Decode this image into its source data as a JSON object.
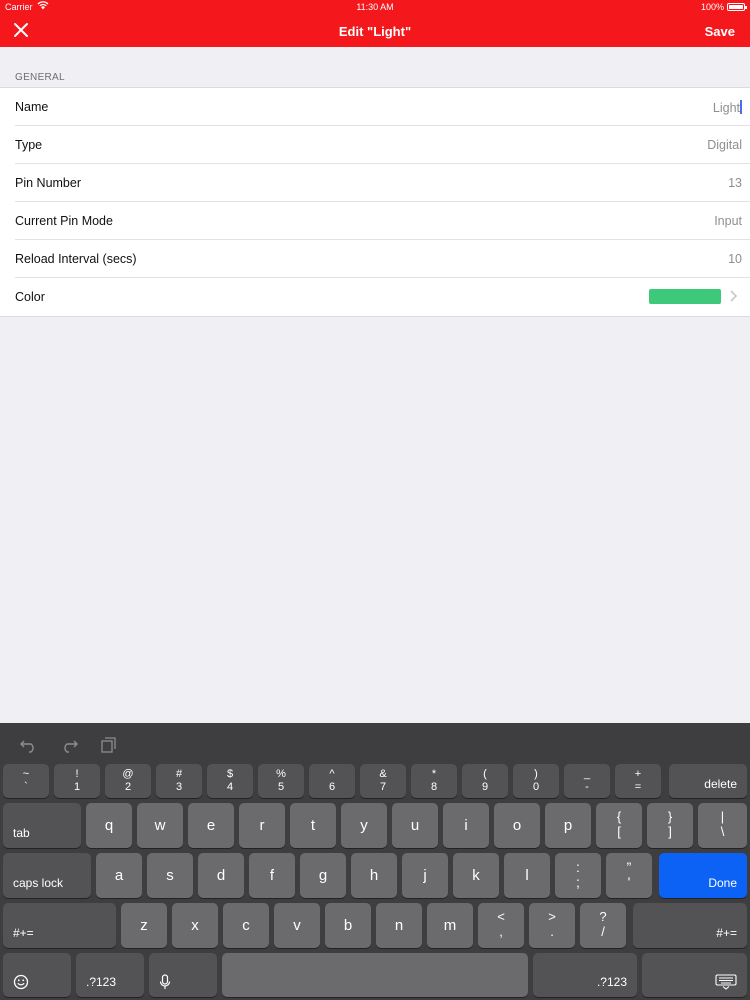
{
  "status_bar": {
    "carrier": "Carrier",
    "time": "11:30 AM",
    "battery": "100%"
  },
  "nav": {
    "title": "Edit \"Light\"",
    "save_label": "Save",
    "close_icon": "close-icon"
  },
  "section": {
    "header": "GENERAL",
    "rows": [
      {
        "label": "Name",
        "value": "Light"
      },
      {
        "label": "Type",
        "value": "Digital"
      },
      {
        "label": "Pin Number",
        "value": "13"
      },
      {
        "label": "Current Pin Mode",
        "value": "Input"
      },
      {
        "label": "Reload Interval (secs)",
        "value": "10"
      },
      {
        "label": "Color",
        "value": ""
      }
    ],
    "color_value": "#3ec97a"
  },
  "keyboard": {
    "number_row": [
      {
        "top": "~",
        "bottom": "`"
      },
      {
        "top": "!",
        "bottom": "1"
      },
      {
        "top": "@",
        "bottom": "2"
      },
      {
        "top": "#",
        "bottom": "3"
      },
      {
        "top": "$",
        "bottom": "4"
      },
      {
        "top": "%",
        "bottom": "5"
      },
      {
        "top": "^",
        "bottom": "6"
      },
      {
        "top": "&",
        "bottom": "7"
      },
      {
        "top": "*",
        "bottom": "8"
      },
      {
        "top": "(",
        "bottom": "9"
      },
      {
        "top": ")",
        "bottom": "0"
      },
      {
        "top": "_",
        "bottom": "-"
      },
      {
        "top": "+",
        "bottom": "="
      }
    ],
    "delete_label": "delete",
    "tab_label": "tab",
    "row1_letters": [
      "q",
      "w",
      "e",
      "r",
      "t",
      "y",
      "u",
      "i",
      "o",
      "p"
    ],
    "row1_symbols": [
      {
        "top": "{",
        "bottom": "["
      },
      {
        "top": "}",
        "bottom": "]"
      },
      {
        "top": "|",
        "bottom": "\\"
      }
    ],
    "caps_label": "caps lock",
    "row2_letters": [
      "a",
      "s",
      "d",
      "f",
      "g",
      "h",
      "j",
      "k",
      "l"
    ],
    "row2_symbols": [
      {
        "top": ":",
        "bottom": ";"
      },
      {
        "top": "”",
        "bottom": "'"
      }
    ],
    "done_label": "Done",
    "symbols_label": "#+=",
    "row3_letters": [
      "z",
      "x",
      "c",
      "v",
      "b",
      "n",
      "m"
    ],
    "row3_symbols": [
      {
        "top": "<",
        "bottom": ","
      },
      {
        "top": ">",
        "bottom": "."
      },
      {
        "top": "?",
        "bottom": "/"
      }
    ],
    "numbers_label": ".?123",
    "colors": {
      "done": "#0c62f5",
      "header": "#f4171b"
    }
  }
}
